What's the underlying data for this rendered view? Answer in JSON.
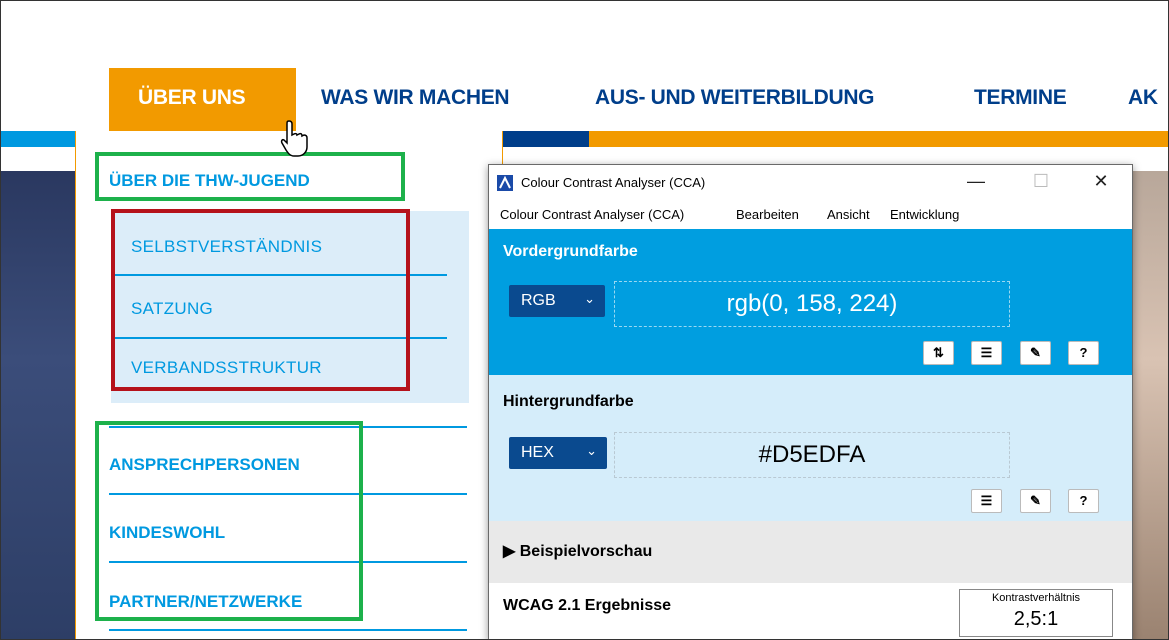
{
  "nav": {
    "active": "ÜBER UNS",
    "items": [
      "WAS WIR MACHEN",
      "AUS- UND WEITERBILDUNG",
      "TERMINE",
      "AK"
    ]
  },
  "dropdown": {
    "heading": "ÜBER DIE THW-JUGEND",
    "sub_items": [
      "SELBSTVERSTÄNDNIS",
      "SATZUNG",
      "VERBANDSSTRUKTUR"
    ],
    "items": [
      "ANSPRECHPERSONEN",
      "KINDESWOHL",
      "PARTNER/NETZWERKE"
    ]
  },
  "cca": {
    "title": "Colour Contrast Analyser (CCA)",
    "window_controls": [
      "—",
      "☐",
      "✕"
    ],
    "menu": [
      "Colour Contrast Analyser (CCA)",
      "Bearbeiten",
      "Ansicht",
      "Entwicklung"
    ],
    "foreground": {
      "title": "Vordergrundfarbe",
      "format": "RGB",
      "value": "rgb(0, 158, 224)",
      "color": "#009ee0"
    },
    "background": {
      "title": "Hintergrundfarbe",
      "format": "HEX",
      "value": "#D5EDFA",
      "color": "#d5edfa"
    },
    "preview": "▶ Beispielvorschau",
    "results": {
      "title": "WCAG 2.1 Ergebnisse",
      "ratio_label": "Kontrastverhältnis",
      "ratio_value": "2,5:1"
    }
  },
  "colors": {
    "brand_blue": "#003e8a",
    "accent_orange": "#f29a00",
    "link_blue": "#0099e0",
    "annotation_green": "#1db14b",
    "annotation_red": "#b5121b"
  }
}
